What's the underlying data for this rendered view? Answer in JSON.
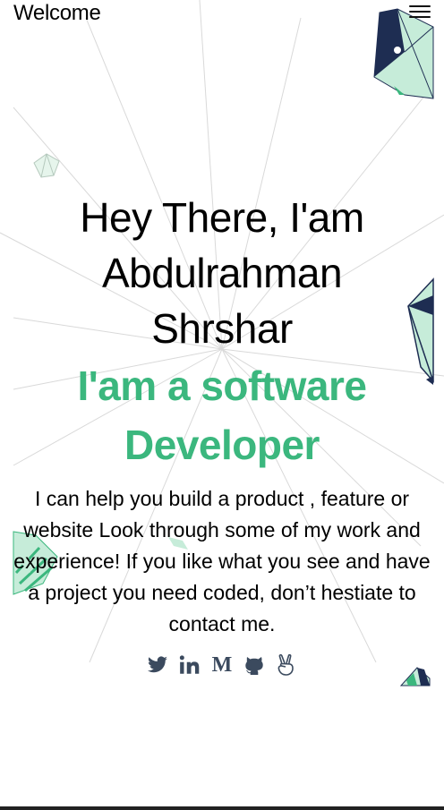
{
  "header": {
    "brand": "Welcome",
    "menu_icon": "hamburger-menu-icon"
  },
  "hero": {
    "greeting_line1": "Hey There, I'am",
    "greeting_line2": "Abdulrahman",
    "greeting_line3": "Shrshar",
    "role_line1": "I'am a software",
    "role_line2": "Developer",
    "intro": "I can help you build a product , feature or website Look through some of my work and experience! If you like what you see and have a project you need coded, don’t hestiate to contact me."
  },
  "socials": [
    {
      "icon": "twitter-icon"
    },
    {
      "icon": "linkedin-icon"
    },
    {
      "icon": "medium-icon"
    },
    {
      "icon": "github-icon"
    },
    {
      "icon": "angellist-icon"
    }
  ],
  "colors": {
    "accent": "#3bb77e",
    "text": "#000000",
    "icon": "#3b4a5e",
    "art_dark": "#1e2d52",
    "art_light": "#c6ecd9"
  }
}
